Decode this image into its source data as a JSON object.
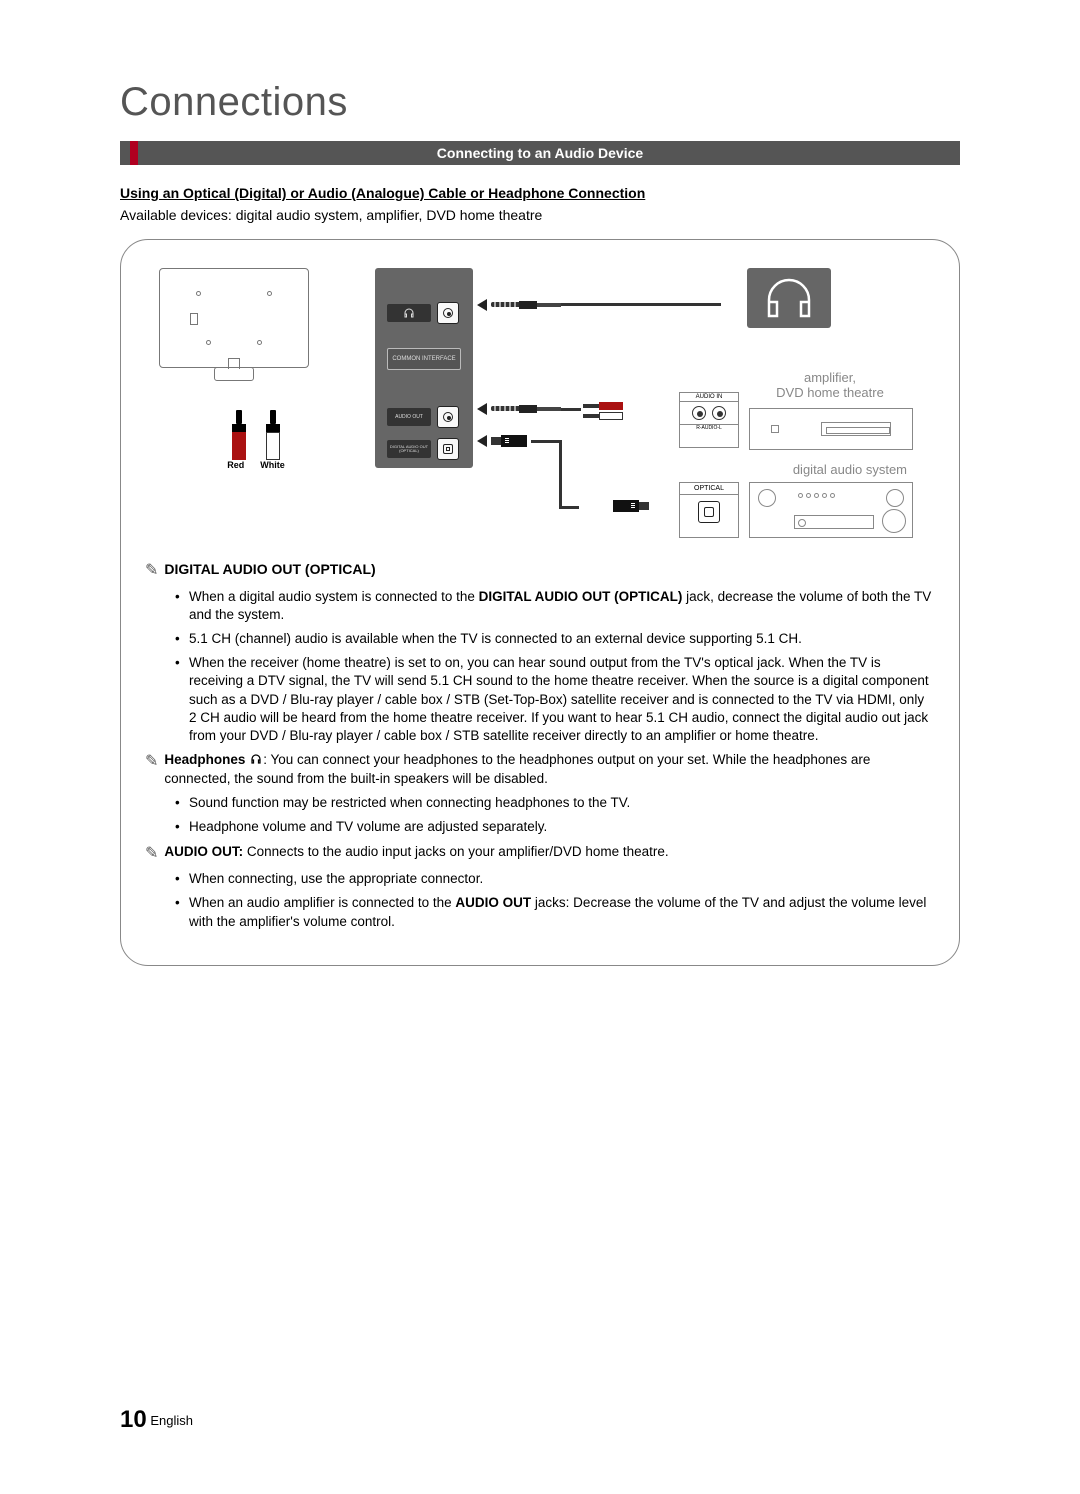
{
  "page_title": "Connections",
  "section_header": "Connecting to an Audio Device",
  "subheading": "Using an Optical (Digital) or Audio (Analogue) Cable or Headphone Connection",
  "available_devices": "Available devices: digital audio system, amplifier, DVD home theatre",
  "diagram": {
    "rca_red_label": "Red",
    "rca_white_label": "White",
    "panel_ci_label": "COMMON INTERFACE",
    "panel_audio_out_label": "AUDIO OUT",
    "panel_optical_label": "DIGITAL AUDIO OUT (OPTICAL)",
    "amp_caption_line1": "amplifier,",
    "amp_caption_line2": "DVD home theatre",
    "amp_audio_in": "AUDIO IN",
    "amp_audio_sub": "R-AUDIO-L",
    "das_caption": "digital audio system",
    "das_optical": "OPTICAL"
  },
  "notes": {
    "digital_audio_title": "DIGITAL AUDIO OUT (OPTICAL)",
    "digital_audio_bullets": [
      "When a digital audio system is connected to the DIGITAL AUDIO OUT (OPTICAL) jack, decrease the volume of both the TV and the system.",
      "5.1 CH (channel) audio is available when the TV is connected to an external device supporting 5.1 CH.",
      "When the receiver (home theatre) is set to on, you can hear sound output from the TV's optical jack. When the TV is receiving a DTV signal, the TV will send 5.1 CH sound to the home theatre receiver. When the source is a digital component such as a DVD / Blu-ray player / cable box / STB (Set-Top-Box) satellite receiver and is connected to the TV via HDMI, only 2 CH audio will be heard from the home theatre receiver. If you want to hear 5.1 CH audio, connect the digital audio out jack from your DVD / Blu-ray player / cable box / STB satellite receiver directly to an amplifier or home theatre."
    ],
    "headphones_title": "Headphones",
    "headphones_intro": ": You can connect your headphones to the headphones output on your set. While the headphones are connected, the sound from the built-in speakers will be disabled.",
    "headphones_bullets": [
      "Sound function may be restricted when connecting headphones to the TV.",
      "Headphone volume and TV volume are adjusted separately."
    ],
    "audio_out_title": "AUDIO OUT:",
    "audio_out_intro": " Connects to the audio input jacks on your amplifier/DVD home theatre.",
    "audio_out_bullets": [
      "When connecting, use the appropriate connector.",
      "When an audio amplifier is connected to the AUDIO OUT jacks: Decrease the volume of the TV and adjust the volume level with the amplifier's volume control."
    ]
  },
  "footer": {
    "page_number": "10",
    "lang": "English"
  }
}
